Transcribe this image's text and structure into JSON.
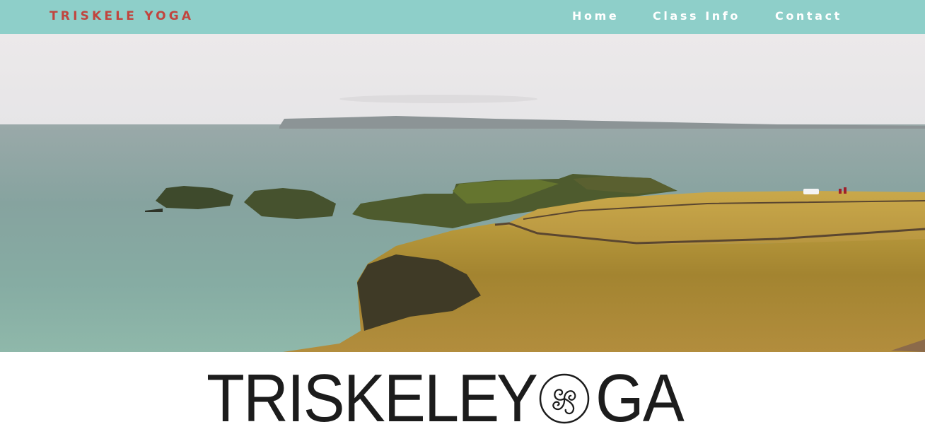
{
  "navbar": {
    "brand": "TRISKELE YOGA",
    "links": [
      {
        "label": "Home"
      },
      {
        "label": "Class Info"
      },
      {
        "label": "Contact"
      }
    ],
    "background": "#8ecfc9",
    "brand_color": "#c1453e"
  },
  "hero": {
    "icon": "coastal-landscape-photo"
  },
  "logo": {
    "part1": "TRISKELE",
    "part2": "Y",
    "part3": "GA",
    "icon": "triskele-spiral-icon"
  }
}
